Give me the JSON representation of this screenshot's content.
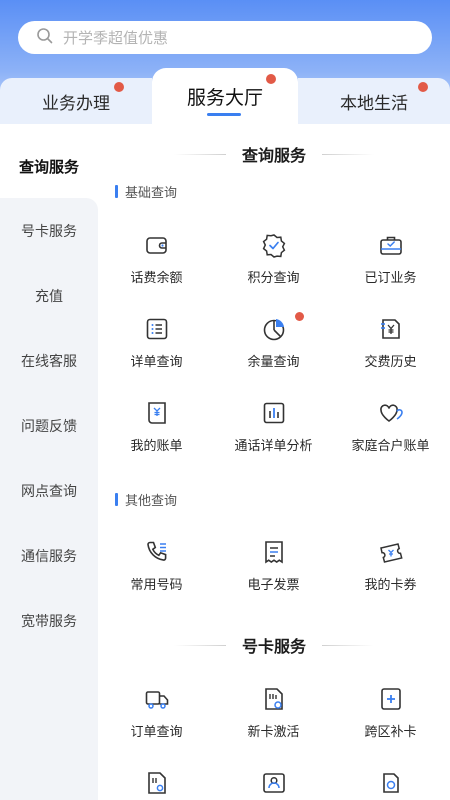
{
  "search": {
    "placeholder": "开学季超值优惠",
    "icon": "search-icon"
  },
  "tabs": [
    {
      "label": "业务办理",
      "badge": true
    },
    {
      "label": "服务大厅",
      "badge": true,
      "active": true
    },
    {
      "label": "本地生活",
      "badge": true
    }
  ],
  "sidebar": {
    "items": [
      {
        "label": "查询服务",
        "active": true
      },
      {
        "label": "号卡服务"
      },
      {
        "label": "充值"
      },
      {
        "label": "在线客服"
      },
      {
        "label": "问题反馈"
      },
      {
        "label": "网点查询"
      },
      {
        "label": "通信服务"
      },
      {
        "label": "宽带服务"
      }
    ]
  },
  "sections": {
    "query": {
      "title": "查询服务",
      "basic": {
        "title": "基础查询",
        "items": [
          {
            "label": "话费余额",
            "icon": "wallet-icon"
          },
          {
            "label": "积分查询",
            "icon": "badge-check-icon"
          },
          {
            "label": "已订业务",
            "icon": "briefcase-check-icon"
          },
          {
            "label": "详单查询",
            "icon": "list-icon"
          },
          {
            "label": "余量查询",
            "icon": "pie-chart-icon",
            "badge": true
          },
          {
            "label": "交费历史",
            "icon": "yen-doc-icon"
          },
          {
            "label": "我的账单",
            "icon": "bill-icon"
          },
          {
            "label": "通话详单分析",
            "icon": "bar-chart-icon"
          },
          {
            "label": "家庭合户账单",
            "icon": "hearts-icon"
          }
        ]
      },
      "other": {
        "title": "其他查询",
        "items": [
          {
            "label": "常用号码",
            "icon": "phone-icon"
          },
          {
            "label": "电子发票",
            "icon": "receipt-icon"
          },
          {
            "label": "我的卡券",
            "icon": "coupon-icon"
          }
        ]
      }
    },
    "card": {
      "title": "号卡服务",
      "items": [
        {
          "label": "订单查询",
          "icon": "truck-icon"
        },
        {
          "label": "新卡激活",
          "icon": "sim-icon"
        },
        {
          "label": "跨区补卡",
          "icon": "plus-doc-icon"
        }
      ]
    }
  },
  "colors": {
    "accent": "#3a7ff0",
    "badge": "#e25a47",
    "header": "#5a8ff5"
  }
}
